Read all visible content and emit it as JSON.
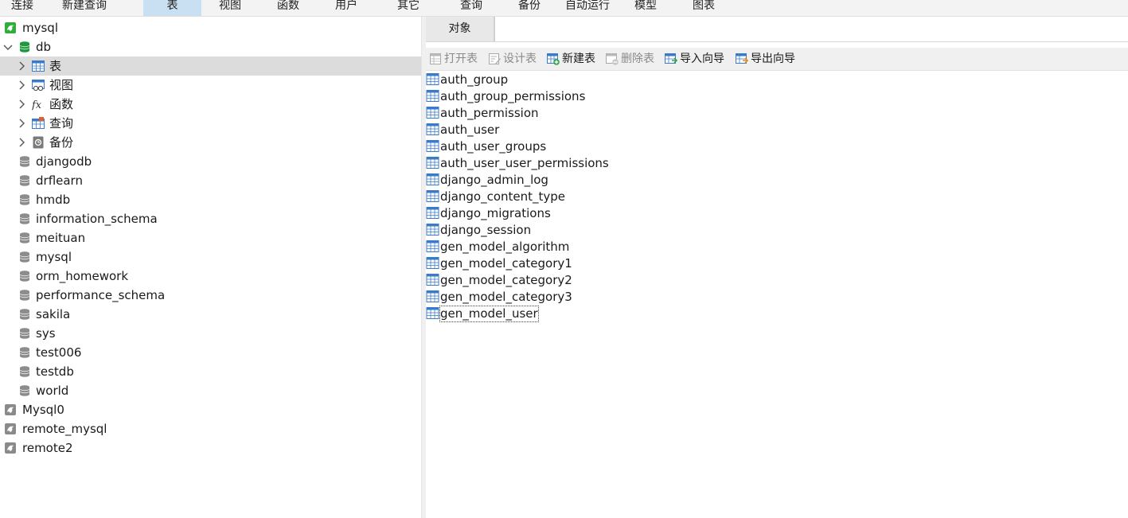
{
  "menu": [
    "连接",
    "新建查询",
    "表",
    "视图",
    "函数",
    "用户",
    "其它",
    "查询",
    "备份",
    "自动运行",
    "模型",
    "图表"
  ],
  "menu_active": "表",
  "tree": {
    "connection_top": "mysql",
    "db": "db",
    "db_children": [
      "表",
      "视图",
      "函数",
      "查询",
      "备份"
    ],
    "databases": [
      "djangodb",
      "drflearn",
      "hmdb",
      "information_schema",
      "meituan",
      "mysql",
      "orm_homework",
      "performance_schema",
      "sakila",
      "sys",
      "test006",
      "testdb",
      "world"
    ],
    "connections": [
      "Mysql0",
      "remote_mysql",
      "remote2"
    ]
  },
  "right": {
    "tab": "对象",
    "toolbar": {
      "open": "打开表",
      "design": "设计表",
      "new": "新建表",
      "delete": "删除表",
      "import": "导入向导",
      "export": "导出向导"
    },
    "tables": [
      "auth_group",
      "auth_group_permissions",
      "auth_permission",
      "auth_user",
      "auth_user_groups",
      "auth_user_user_permissions",
      "django_admin_log",
      "django_content_type",
      "django_migrations",
      "django_session",
      "gen_model_algorithm",
      "gen_model_category1",
      "gen_model_category2",
      "gen_model_category3",
      "gen_model_user"
    ]
  },
  "colors": {
    "selected_row": "#dcdcdc",
    "active_menu": "#c9dff2",
    "connection_green": "#2fae3d",
    "db_green": "#1e9a3c"
  }
}
